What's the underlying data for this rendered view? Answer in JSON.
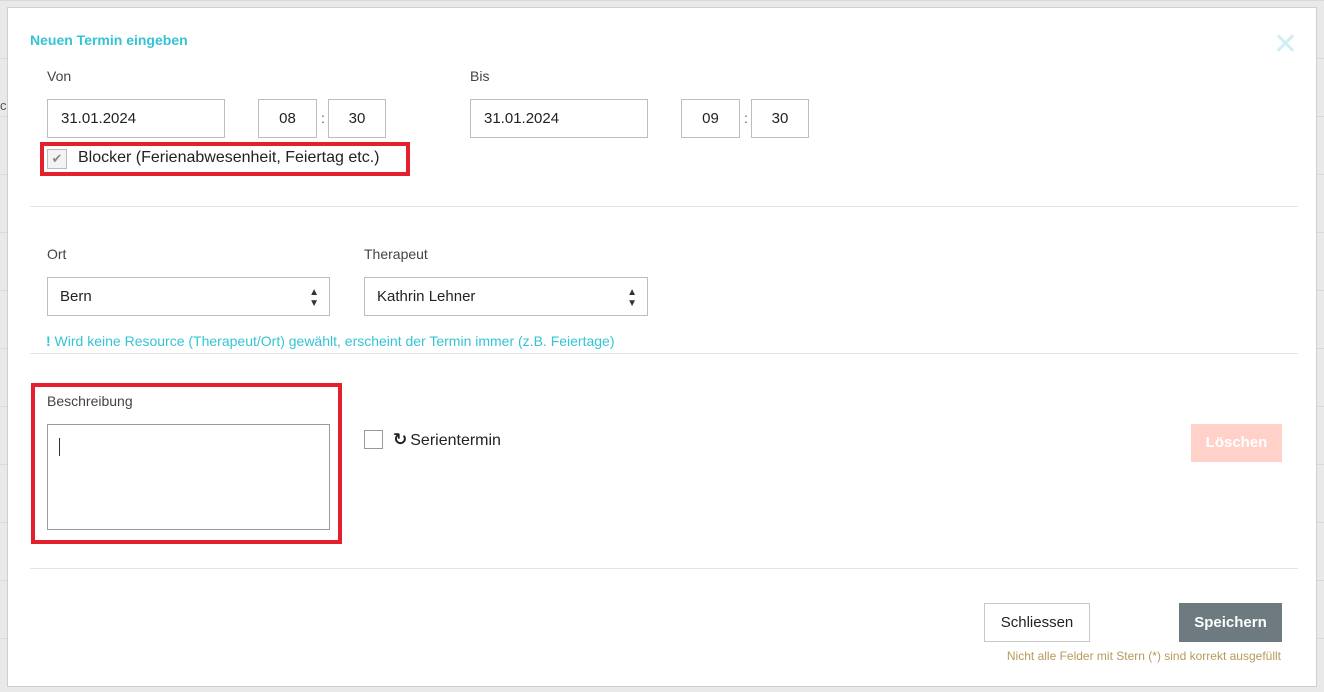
{
  "background_fragment": "c",
  "modal": {
    "title": "Neuen Termin eingeben",
    "close_glyph": "✕"
  },
  "von": {
    "label": "Von",
    "date": "31.01.2024",
    "hour": "08",
    "minute": "30"
  },
  "bis": {
    "label": "Bis",
    "date": "31.01.2024",
    "hour": "09",
    "minute": "30"
  },
  "time_separator": ":",
  "blocker": {
    "label": "Blocker (Ferienabwesenheit, Feiertag etc.)",
    "checked": true,
    "check_glyph": "✔"
  },
  "ort": {
    "label": "Ort",
    "value": "Bern"
  },
  "therapeut": {
    "label": "Therapeut",
    "value": "Kathrin Lehner"
  },
  "select_caret": "▲▼",
  "hint": {
    "mark": "!",
    "text": " Wird keine Resource (Therapeut/Ort) gewählt, erscheint der Termin immer (z.B. Feiertage)"
  },
  "beschreibung": {
    "label": "Beschreibung",
    "value": ""
  },
  "serientermin": {
    "label": "Serientermin",
    "icon_glyph": "↻",
    "checked": false
  },
  "buttons": {
    "loeschen": "Löschen",
    "schliessen": "Schliessen",
    "speichern": "Speichern"
  },
  "footer_note": "Nicht alle Felder mit Stern (*) sind korrekt ausgefüllt",
  "colors": {
    "accent": "#35c4d4",
    "highlight_border": "#e3202b",
    "save_button": "#6d7a7f",
    "delete_button_disabled": "#ffd1c8",
    "warning_text": "#b79a5a"
  }
}
